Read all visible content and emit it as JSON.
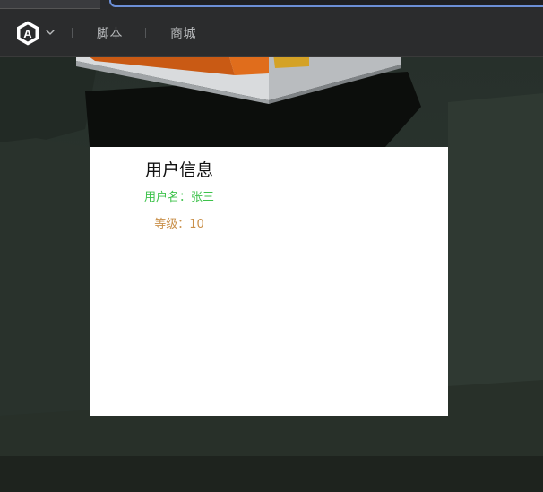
{
  "navbar": {
    "logo_letter": "A",
    "links": [
      "脚本",
      "商城"
    ]
  },
  "panel": {
    "title": "用户信息",
    "username_label": "用户名：",
    "username_value": "张三",
    "level_label": "等级：",
    "level_value": "10"
  },
  "colors": {
    "navbar_bg": "#2b2c2d",
    "nav_text": "#b9bbbd",
    "username_color": "#3cc24a",
    "level_color": "#c9904a",
    "panel_bg": "#ffffff",
    "url_focus": "#6c8fd6"
  },
  "icons": {
    "logo": "hexagon-a-logo-icon",
    "menu": "chevron-down-icon"
  }
}
